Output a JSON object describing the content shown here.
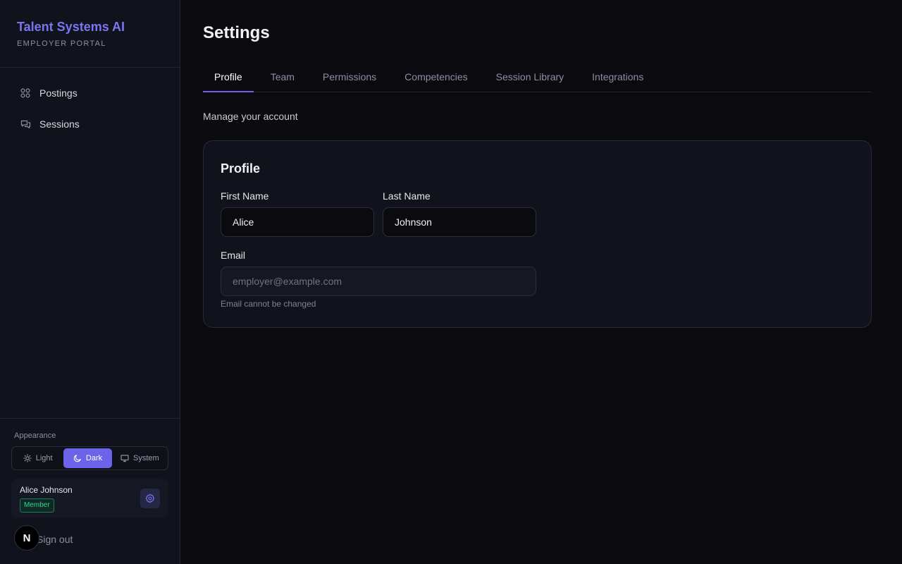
{
  "brand": {
    "title": "Talent Systems AI",
    "subtitle": "EMPLOYER PORTAL"
  },
  "nav": {
    "items": [
      {
        "label": "Postings",
        "icon": "grid-icon"
      },
      {
        "label": "Sessions",
        "icon": "chat-icon"
      }
    ]
  },
  "appearance": {
    "label": "Appearance",
    "options": [
      {
        "label": "Light",
        "icon": "sun-icon"
      },
      {
        "label": "Dark",
        "icon": "moon-icon"
      },
      {
        "label": "System",
        "icon": "monitor-icon"
      }
    ],
    "selected": "Dark"
  },
  "user": {
    "name": "Alice Johnson",
    "role": "Member"
  },
  "signout_label": "Sign out",
  "dev_badge": "N",
  "page": {
    "title": "Settings",
    "tabs": [
      "Profile",
      "Team",
      "Permissions",
      "Competencies",
      "Session Library",
      "Integrations"
    ],
    "active_tab": "Profile",
    "subtitle": "Manage your account"
  },
  "profile": {
    "title": "Profile",
    "first_name_label": "First Name",
    "first_name_value": "Alice",
    "last_name_label": "Last Name",
    "last_name_value": "Johnson",
    "email_label": "Email",
    "email_placeholder": "employer@example.com",
    "email_help": "Email cannot be changed"
  },
  "colors": {
    "accent": "#6d63ea",
    "brand": "#7b75f2",
    "badge": "#34d399"
  }
}
